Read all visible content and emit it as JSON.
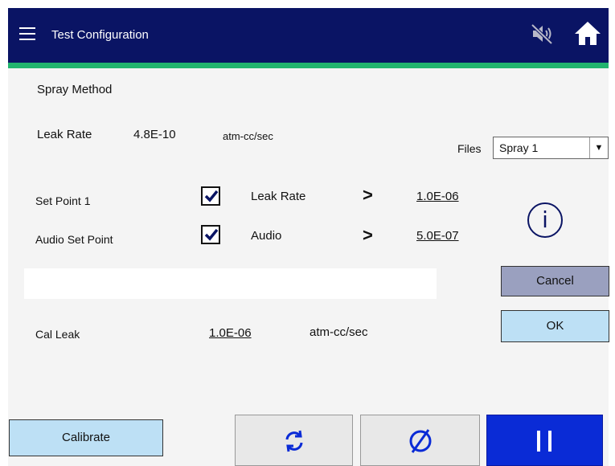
{
  "header": {
    "title": "Test Configuration",
    "menu_icon": "hamburger-menu-icon",
    "mute_icon": "speaker-muted-icon",
    "home_icon": "home-icon"
  },
  "mode": {
    "label": "Spray Method"
  },
  "leak_rate": {
    "label": "Leak Rate",
    "value": "4.8E-10",
    "unit": "atm-cc/sec"
  },
  "files": {
    "label": "Files",
    "selected": "Spray 1"
  },
  "setpoints": [
    {
      "name": "Set Point 1",
      "checked": true,
      "type": "Leak Rate",
      "comparator": ">",
      "value": "1.0E-06"
    },
    {
      "name": "Audio Set Point",
      "checked": true,
      "type": "Audio",
      "comparator": ">",
      "value": "5.0E-07"
    }
  ],
  "info_glyph": "i",
  "buttons": {
    "cancel": "Cancel",
    "ok": "OK",
    "calibrate": "Calibrate"
  },
  "cal_leak": {
    "label": "Cal Leak",
    "value": "1.0E-06",
    "unit": "atm-cc/sec"
  },
  "toolbar": {
    "refresh_icon": "refresh-icon",
    "stop_icon": "stop-icon",
    "pause_icon": "pause-icon"
  },
  "colors": {
    "header": "#0a1464",
    "accent_line": "#22b46e",
    "pause_button": "#0a2bd6",
    "light_button": "#bde0f5",
    "cancel_button": "#9aa0bf"
  }
}
